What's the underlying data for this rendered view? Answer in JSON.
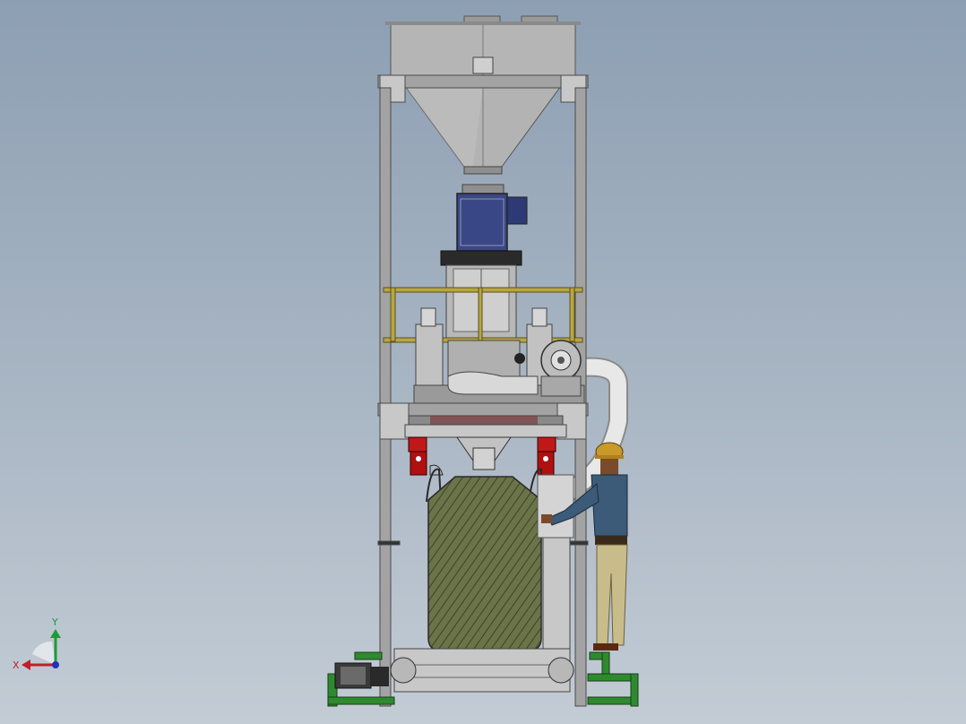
{
  "viewport": {
    "background_top": "#8d9fb3",
    "background_bottom": "#c3ccd5"
  },
  "triad": {
    "x_label": "X",
    "y_label": "Y",
    "x_color": "#c0202a",
    "y_color": "#1f9a3a",
    "z_color": "#2030c0"
  },
  "model": {
    "frame_color": "#a0a0a0",
    "hopper_color": "#b3b3b3",
    "motor_color": "#3c4a8c",
    "rail_color": "#b8a640",
    "gripper_color": "#c01818",
    "base_color": "#2f8a2f",
    "bag_color": "#5a6a3a",
    "duct_color": "#e6e6e6"
  },
  "operator": {
    "helmet_color": "#c89a2a",
    "shirt_color": "#3b5b78",
    "pants_color": "#c8bd8a",
    "skin_color": "#7a4a2c"
  }
}
